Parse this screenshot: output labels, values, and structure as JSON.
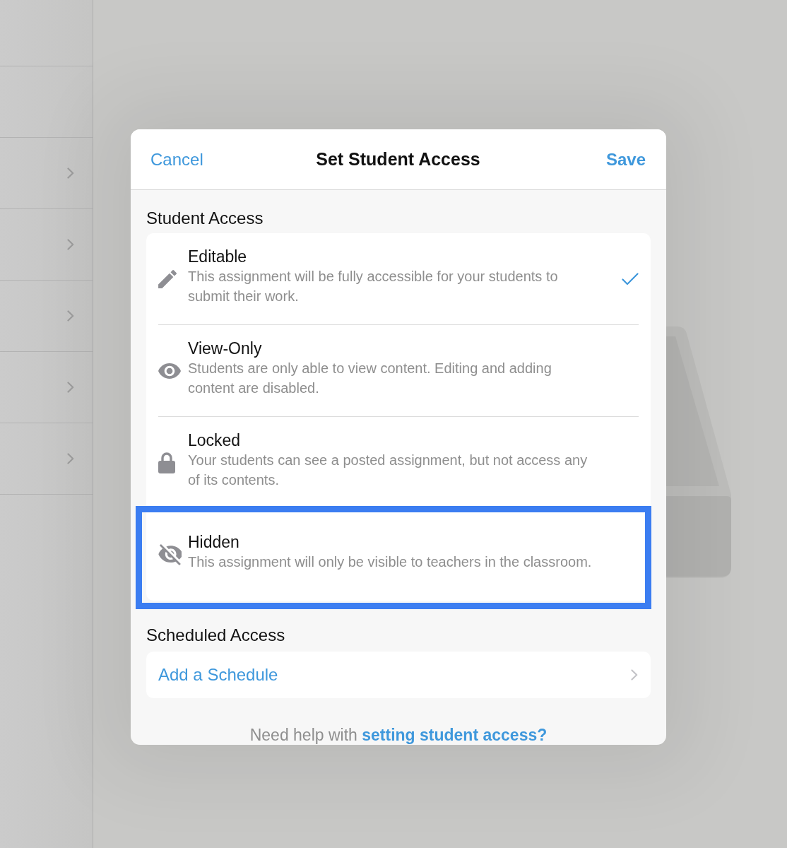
{
  "sidebar": {
    "rows": [
      {
        "kind": "plain"
      },
      {
        "kind": "plain"
      },
      {
        "kind": "disclosure"
      },
      {
        "kind": "disclosure"
      },
      {
        "kind": "disclosure"
      },
      {
        "kind": "disclosure"
      },
      {
        "kind": "disclosure"
      }
    ]
  },
  "dialog": {
    "cancel": "Cancel",
    "title": "Set Student Access",
    "save": "Save"
  },
  "student_access": {
    "heading": "Student Access",
    "options": [
      {
        "kind": "edit",
        "title": "Editable",
        "description": "This assignment will be fully accessible for your students to submit their work.",
        "selected": true,
        "highlighted": false
      },
      {
        "kind": "view",
        "title": "View-Only",
        "description": "Students are only able to view content. Editing and adding content are disabled.",
        "selected": false,
        "highlighted": false
      },
      {
        "kind": "lock",
        "title": "Locked",
        "description": "Your students can see a posted assignment, but not access any of its contents.",
        "selected": false,
        "highlighted": false
      },
      {
        "kind": "hide",
        "title": "Hidden",
        "description": "This assignment will only be visible to teachers in the classroom.",
        "selected": false,
        "highlighted": true
      }
    ]
  },
  "scheduled_access": {
    "heading": "Scheduled Access",
    "action": "Add a Schedule"
  },
  "help": {
    "text": "Need help with",
    "link": "setting student access?"
  }
}
